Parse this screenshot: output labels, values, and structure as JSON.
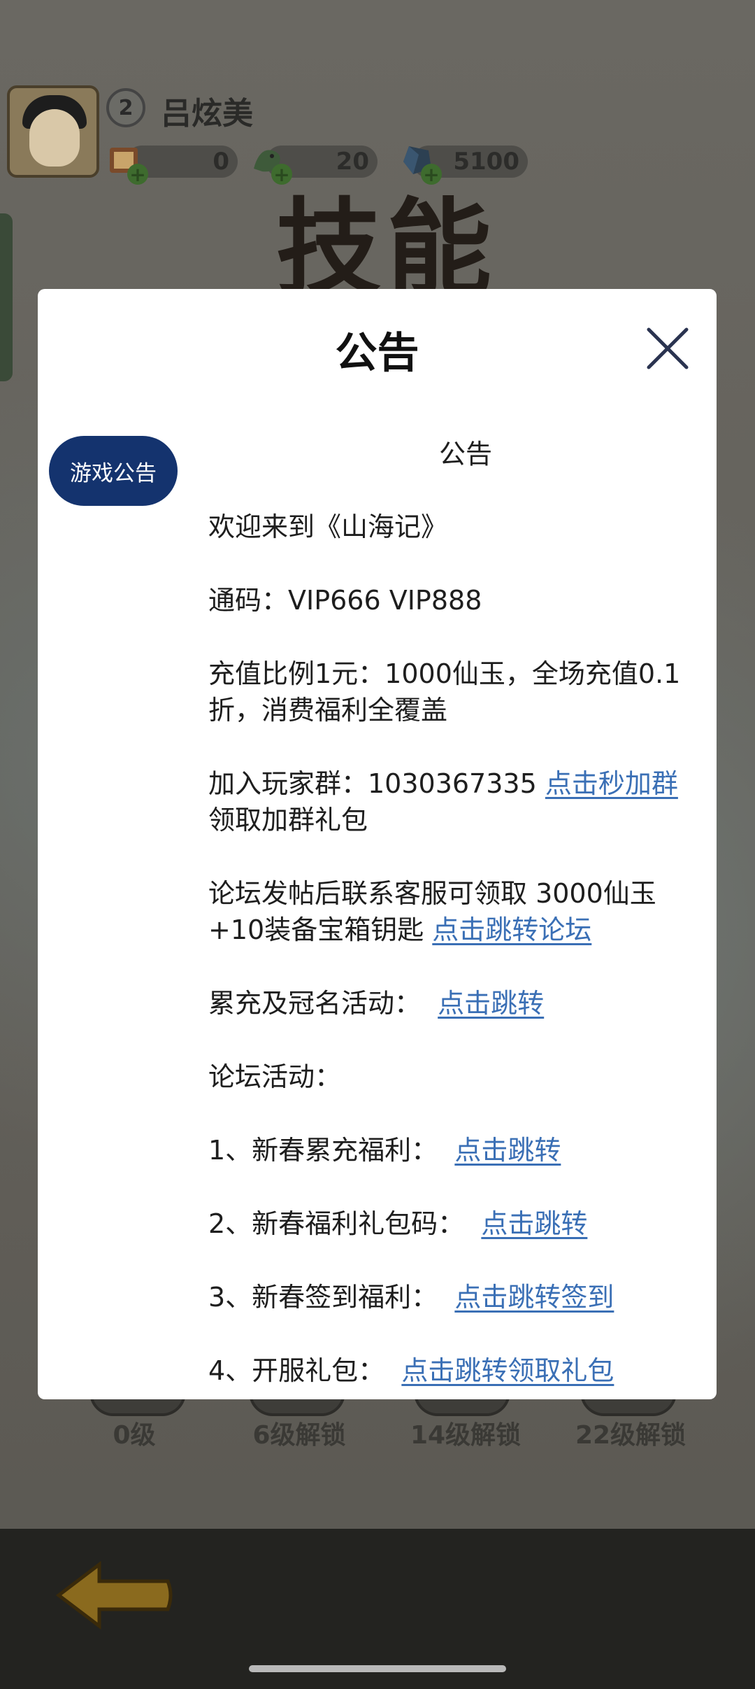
{
  "player": {
    "name": "吕炫美",
    "level": "2"
  },
  "resources": [
    {
      "icon": "scroll-chest-icon",
      "value": "0"
    },
    {
      "icon": "dragon-icon",
      "value": "20"
    },
    {
      "icon": "crystal-icon",
      "value": "5100"
    }
  ],
  "background": {
    "skill_title": "技能",
    "skill_slots": [
      "0级",
      "6级解锁",
      "14级解锁",
      "22级解锁"
    ]
  },
  "modal": {
    "title": "公告",
    "close_icon": "close-icon",
    "tabs": [
      {
        "label": "游戏公告",
        "selected": true
      }
    ],
    "heading": "公告",
    "welcome": "欢迎来到《山海记》",
    "code_line": "通码：VIP666 VIP888",
    "recharge_line": "充值比例1元：1000仙玉，全场充值0.1折，消费福利全覆盖",
    "group_prefix": "加入玩家群：1030367335 ",
    "group_link": "点击秒加群",
    "group_suffix": " 领取加群礼包",
    "forum_prefix": "论坛发帖后联系客服可领取 3000仙玉+10装备宝箱钥匙 ",
    "forum_link": "点击跳转论坛",
    "recharge_event_prefix": "累充及冠名活动：  ",
    "recharge_event_link": "点击跳转",
    "forum_events_label": "论坛活动：",
    "events": [
      {
        "prefix": "1、新春累充福利：  ",
        "link": "点击跳转"
      },
      {
        "prefix": "2、新春福利礼包码：  ",
        "link": "点击跳转"
      },
      {
        "prefix": "3、新春签到福利：  ",
        "link": "点击跳转签到"
      },
      {
        "prefix": "4、开服礼包：  ",
        "link": "点击跳转领取礼包"
      }
    ]
  },
  "colors": {
    "tab_bg": "#14336e",
    "link": "#3a6fb5",
    "modal_bg": "#ffffff"
  }
}
